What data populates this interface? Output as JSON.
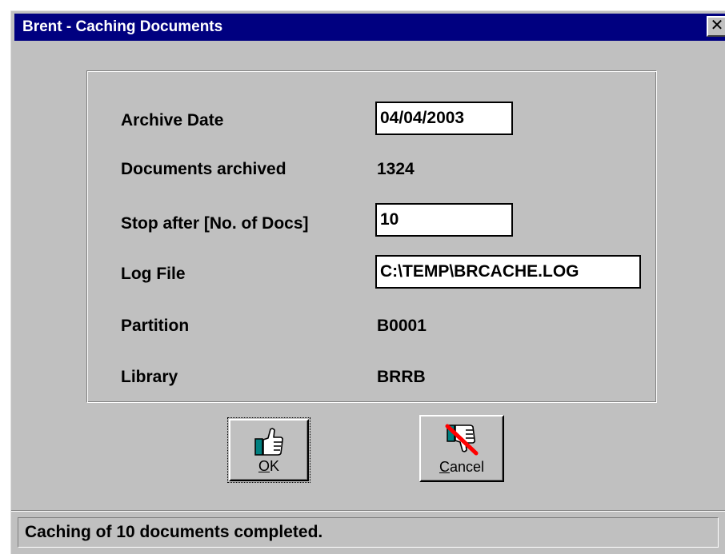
{
  "window": {
    "title": "Brent - Caching Documents",
    "close_glyph": "✕"
  },
  "form": {
    "archive_date": {
      "label": "Archive Date",
      "value": "04/04/2003"
    },
    "documents_archived": {
      "label": "Documents archived",
      "value": "1324"
    },
    "stop_after": {
      "label": "Stop after [No. of Docs]",
      "value": "10"
    },
    "log_file": {
      "label": "Log File",
      "value": "C:\\TEMP\\BRCACHE.LOG"
    },
    "partition": {
      "label": "Partition",
      "value": "B0001"
    },
    "library": {
      "label": "Library",
      "value": "BRRB"
    }
  },
  "buttons": {
    "ok": {
      "accel": "O",
      "rest": "K",
      "icon": "thumbs-up-icon"
    },
    "cancel": {
      "accel": "C",
      "rest": "ancel",
      "icon": "thumbs-down-icon"
    }
  },
  "status": {
    "message": "Caching of 10 documents completed."
  },
  "colors": {
    "titlebar": "#000080",
    "face": "#c0c0c0",
    "cancel_slash": "#ff0000",
    "icon_accent": "#008080"
  }
}
